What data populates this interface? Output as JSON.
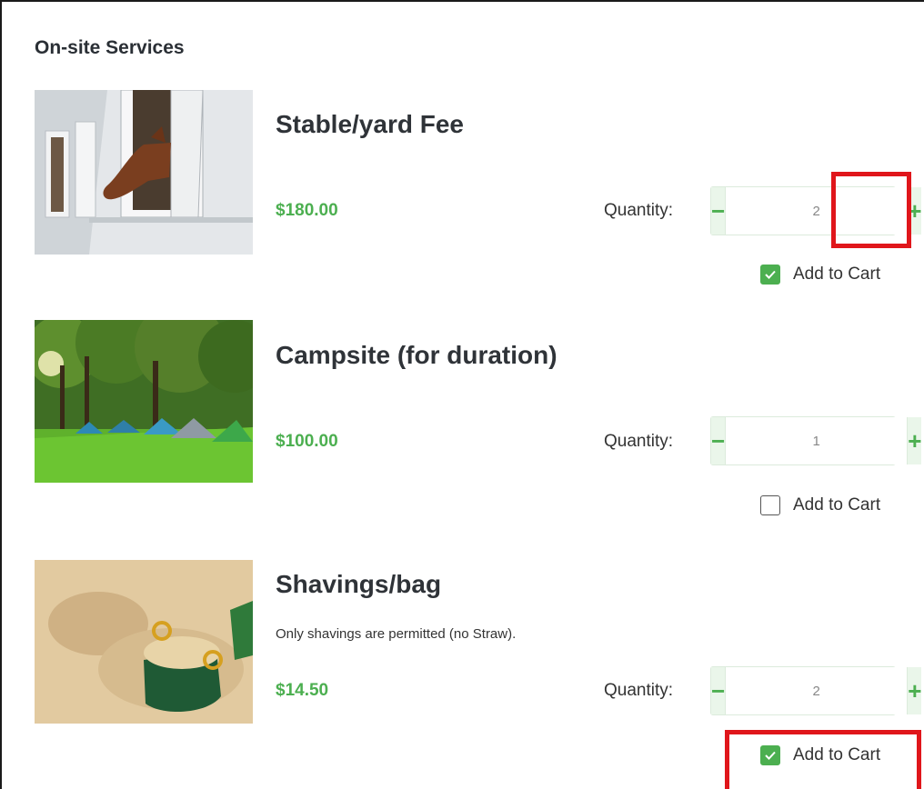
{
  "section_title": "On-site Services",
  "colors": {
    "accent": "#4caf50",
    "highlight": "#e0161b"
  },
  "items": [
    {
      "title": "Stable/yard Fee",
      "description": "",
      "price": "$180.00",
      "quantity_label": "Quantity:",
      "quantity": "2",
      "add_to_cart_label": "Add to Cart",
      "add_to_cart_checked": true,
      "image_icon": "horse-stable-image"
    },
    {
      "title": "Campsite (for duration)",
      "description": "",
      "price": "$100.00",
      "quantity_label": "Quantity:",
      "quantity": "1",
      "add_to_cart_label": "Add to Cart",
      "add_to_cart_checked": false,
      "image_icon": "campsite-image"
    },
    {
      "title": "Shavings/bag",
      "description": "Only shavings are permitted (no Straw).",
      "price": "$14.50",
      "quantity_label": "Quantity:",
      "quantity": "2",
      "add_to_cart_label": "Add to Cart",
      "add_to_cart_checked": true,
      "image_icon": "shavings-bag-image"
    }
  ],
  "stepper": {
    "minus": "−",
    "plus": "+"
  }
}
